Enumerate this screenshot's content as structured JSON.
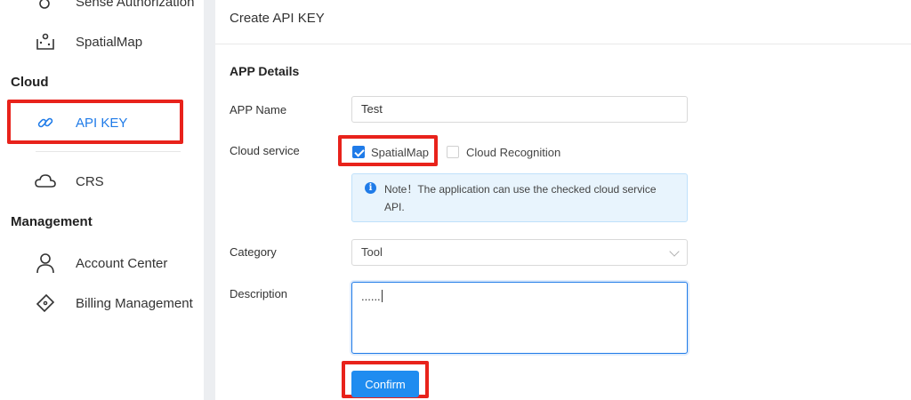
{
  "sidebar": {
    "items_top": [
      {
        "label": "Sense Authorization",
        "icon": "sense-icon"
      },
      {
        "label": "SpatialMap",
        "icon": "spatialmap-icon"
      }
    ],
    "section_cloud": "Cloud",
    "cloud_items": [
      {
        "label": "API KEY",
        "icon": "link-icon",
        "active": true
      },
      {
        "label": "CRS",
        "icon": "cloud-icon"
      }
    ],
    "section_management": "Management",
    "management_items": [
      {
        "label": "Account Center",
        "icon": "user-icon"
      },
      {
        "label": "Billing Management",
        "icon": "ticket-icon"
      }
    ]
  },
  "main": {
    "page_title": "Create API KEY",
    "section_title": "APP Details",
    "form": {
      "app_name_label": "APP Name",
      "app_name_value": "Test",
      "cloud_service_label": "Cloud service",
      "services": [
        {
          "label": "SpatialMap",
          "checked": true
        },
        {
          "label": "Cloud Recognition",
          "checked": false
        }
      ],
      "notice_text": "Note！The application can use the checked cloud service API.",
      "category_label": "Category",
      "category_value": "Tool",
      "description_label": "Description",
      "description_value": "......",
      "confirm_label": "Confirm"
    }
  },
  "colors": {
    "accent": "#1f7be8",
    "highlight": "#e8221b"
  }
}
